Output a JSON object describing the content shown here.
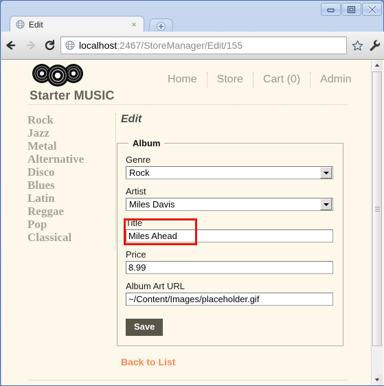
{
  "browser": {
    "tab": {
      "title": "Edit",
      "favicon": "globe-icon",
      "close": "×"
    },
    "new_tab_label": "+",
    "url": {
      "host": "localhost",
      "rest": ":2467/StoreManager/Edit/155"
    },
    "back_label": "←",
    "forward_label": "→",
    "reload_label": "↻",
    "star_icon": "star-icon",
    "wrench_icon": "wrench-icon",
    "window_controls": {
      "minimize": "minimize-icon",
      "maximize": "maximize-icon",
      "close": "close-icon"
    }
  },
  "site": {
    "title": "Starter MUSIC",
    "logo": "vinyl-records-logo",
    "nav": [
      {
        "label": "Home"
      },
      {
        "label": "Store"
      },
      {
        "label": "Cart (0)"
      },
      {
        "label": "Admin"
      }
    ]
  },
  "sidebar": {
    "genres": [
      {
        "label": "Rock"
      },
      {
        "label": "Jazz"
      },
      {
        "label": "Metal"
      },
      {
        "label": "Alternative"
      },
      {
        "label": "Disco"
      },
      {
        "label": "Blues"
      },
      {
        "label": "Latin"
      },
      {
        "label": "Reggae"
      },
      {
        "label": "Pop"
      },
      {
        "label": "Classical"
      }
    ]
  },
  "main": {
    "heading": "Edit",
    "fieldset_legend": "Album",
    "fields": {
      "genre": {
        "label": "Genre",
        "value": "Rock"
      },
      "artist": {
        "label": "Artist",
        "value": "Miles Davis"
      },
      "title": {
        "label": "Title",
        "value": "Miles Ahead"
      },
      "price": {
        "label": "Price",
        "value": "8.99"
      },
      "album_art": {
        "label": "Album Art URL",
        "value": "~/Content/Images/placeholder.gif"
      }
    },
    "save_label": "Save",
    "back_link": "Back to List"
  },
  "annotation": {
    "color": "#e8130f",
    "target": "genre-field"
  },
  "colors": {
    "page_background": "#fdf8e9",
    "accent_link": "#f58a5c",
    "save_button": "#595647",
    "sidebar_text": "#aaa496",
    "nav_text": "#a09a86"
  }
}
